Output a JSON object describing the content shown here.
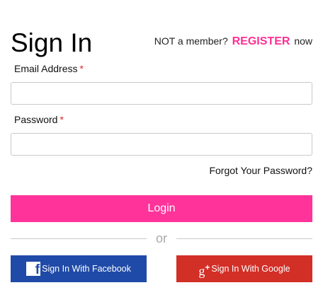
{
  "header": {
    "title": "Sign In",
    "member_prefix": "NOT a member?",
    "register_label": "REGISTER",
    "member_suffix": "now"
  },
  "form": {
    "email": {
      "label": "Email Address",
      "required_mark": "*",
      "value": "",
      "placeholder": ""
    },
    "password": {
      "label": "Password",
      "required_mark": "*",
      "value": "",
      "placeholder": ""
    },
    "forgot_label": "Forgot Your Password?",
    "login_label": "Login"
  },
  "divider": {
    "label": "or"
  },
  "social": {
    "facebook_label": "Sign In With Facebook",
    "google_label": "Sign In With Google"
  },
  "colors": {
    "accent": "#ff3399",
    "register": "#ff2f92",
    "required": "#e0262a",
    "facebook": "#1f4aa8",
    "google": "#d22f27"
  },
  "icons": {
    "facebook": "facebook-icon",
    "google": "google-plus-icon"
  }
}
